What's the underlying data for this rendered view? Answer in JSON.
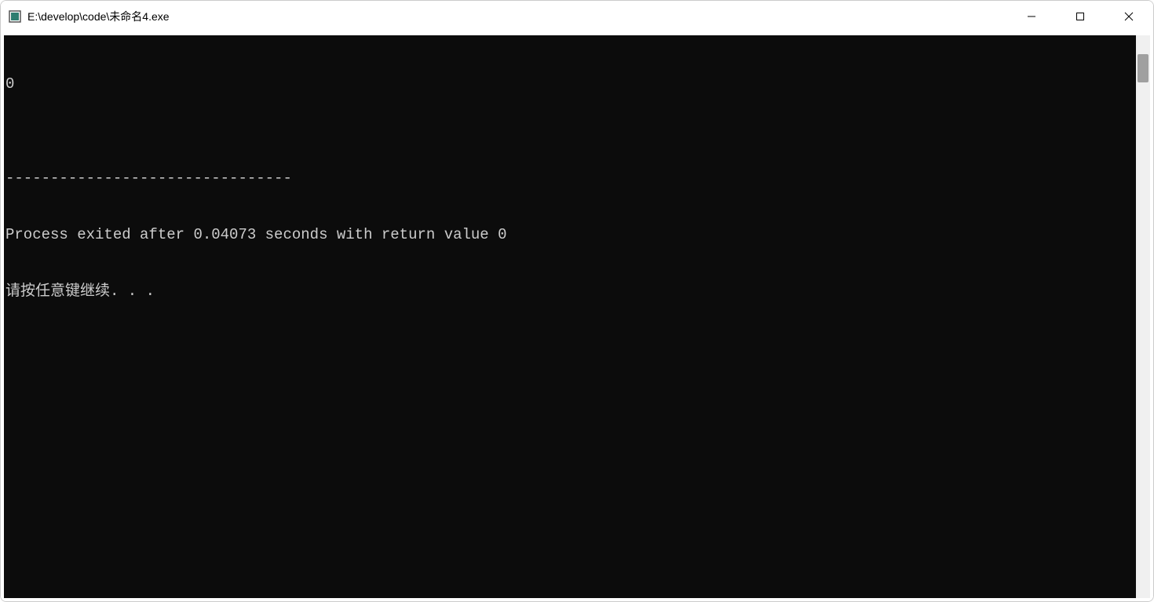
{
  "window": {
    "title": "E:\\develop\\code\\未命名4.exe"
  },
  "terminal": {
    "lines": [
      "0",
      "",
      "--------------------------------",
      "Process exited after 0.04073 seconds with return value 0",
      "请按任意键继续. . ."
    ]
  }
}
